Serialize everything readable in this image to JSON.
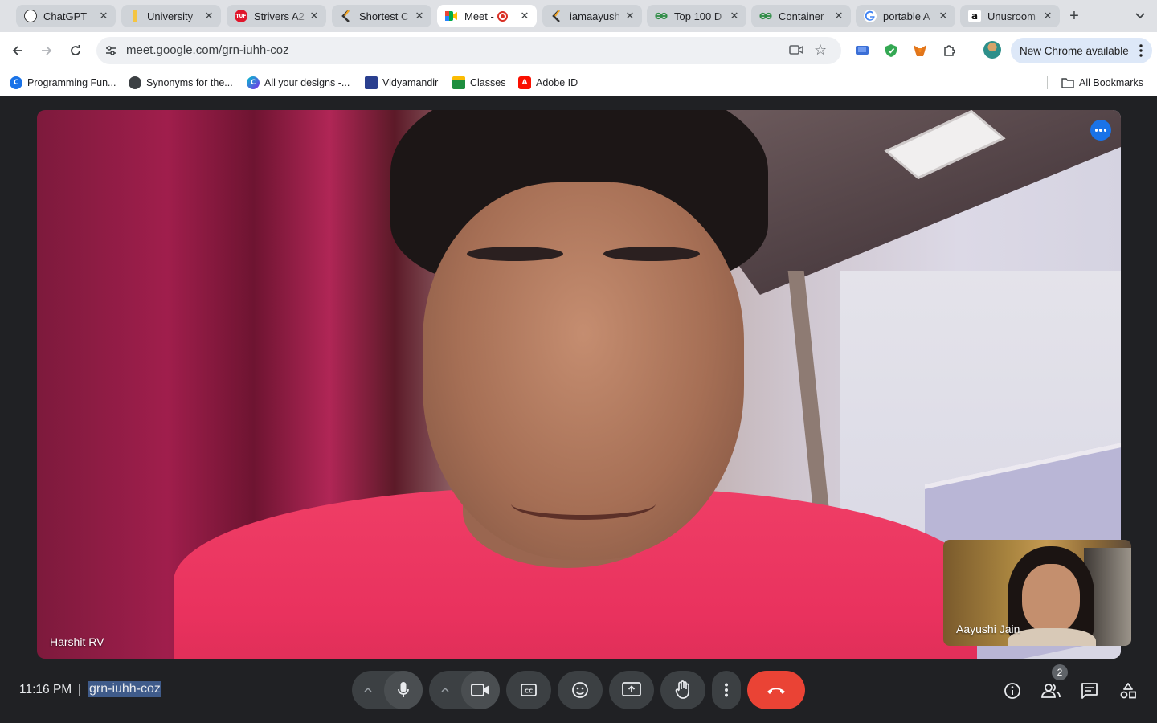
{
  "browser": {
    "tabs": [
      {
        "title": "ChatGPT",
        "icon": "chatgpt-icon"
      },
      {
        "title": "University",
        "icon": "university-icon"
      },
      {
        "title": "Strivers A2",
        "icon": "tuf-icon",
        "icon_text": "TUF"
      },
      {
        "title": "Shortest C",
        "icon": "codolio-icon"
      },
      {
        "title": "Meet -",
        "icon": "google-meet-icon",
        "active": true,
        "recording": true
      },
      {
        "title": "iamaayush",
        "icon": "codolio-icon"
      },
      {
        "title": "Top 100 D",
        "icon": "gfg-icon"
      },
      {
        "title": "Container",
        "icon": "gfg-icon"
      },
      {
        "title": "portable A",
        "icon": "google-icon"
      },
      {
        "title": "Unusroom",
        "icon": "amazon-icon",
        "icon_text": "a"
      }
    ],
    "close_glyph": "✕",
    "new_tab_glyph": "+",
    "url": "meet.google.com/grn-iuhh-coz",
    "update_label": "New Chrome available",
    "bookmarks": [
      {
        "label": "Programming Fun...",
        "icon": "programming-icon",
        "icon_text": "C"
      },
      {
        "label": "Synonyms for the...",
        "icon": "thesaurus-icon"
      },
      {
        "label": "All your designs -...",
        "icon": "canva-icon",
        "icon_text": "C"
      },
      {
        "label": "Vidyamandir",
        "icon": "vidyamandir-icon"
      },
      {
        "label": "Classes",
        "icon": "classroom-icon"
      },
      {
        "label": "Adobe ID",
        "icon": "adobe-icon",
        "icon_text": "A"
      }
    ],
    "all_bookmarks_label": "All Bookmarks"
  },
  "meet": {
    "main_participant": "Harshit RV",
    "self_participant": "Aayushi Jain",
    "clock": "11:16 PM",
    "separator": "|",
    "meeting_code": "grn-iuhh-coz",
    "participant_count": "2"
  },
  "colors": {
    "end_call": "#ea4335",
    "meet_bg": "#202124",
    "control_bg": "#3c4043",
    "accent": "#1a73e8"
  }
}
